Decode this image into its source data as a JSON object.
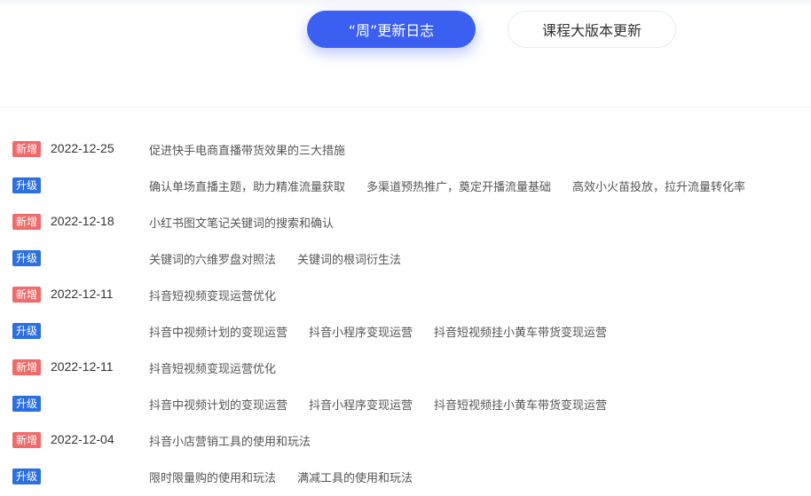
{
  "tabs": [
    {
      "label": "“周”更新日志",
      "active": true
    },
    {
      "label": "课程大版本更新",
      "active": false
    }
  ],
  "colors": {
    "accent": "#3b5ff0",
    "badge_new": "#f06a6a",
    "badge_upgrade": "#2c6fe0"
  },
  "rows": [
    {
      "badge": "新增",
      "kind": "new",
      "date": "2022-12-25",
      "items": [
        "促进快手电商直播带货效果的三大措施"
      ]
    },
    {
      "badge": "升级",
      "kind": "up",
      "date": "",
      "items": [
        "确认单场直播主题，助力精准流量获取",
        "多渠道预热推广，奠定开播流量基础",
        "高效小火苗投放，拉升流量转化率"
      ]
    },
    {
      "badge": "新增",
      "kind": "new",
      "date": "2022-12-18",
      "items": [
        "小红书图文笔记关键词的搜索和确认"
      ]
    },
    {
      "badge": "升级",
      "kind": "up",
      "date": "",
      "items": [
        "关键词的六维罗盘对照法",
        "关键词的根词衍生法"
      ]
    },
    {
      "badge": "新增",
      "kind": "new",
      "date": "2022-12-11",
      "items": [
        "抖音短视频变现运营优化"
      ]
    },
    {
      "badge": "升级",
      "kind": "up",
      "date": "",
      "items": [
        "抖音中视频计划的变现运营",
        "抖音小程序变现运营",
        "抖音短视频挂小黄车带货变现运营"
      ]
    },
    {
      "badge": "新增",
      "kind": "new",
      "date": "2022-12-11",
      "items": [
        "抖音短视频变现运营优化"
      ]
    },
    {
      "badge": "升级",
      "kind": "up",
      "date": "",
      "items": [
        "抖音中视频计划的变现运营",
        "抖音小程序变现运营",
        "抖音短视频挂小黄车带货变现运营"
      ]
    },
    {
      "badge": "新增",
      "kind": "new",
      "date": "2022-12-04",
      "items": [
        "抖音小店营销工具的使用和玩法"
      ]
    },
    {
      "badge": "升级",
      "kind": "up",
      "date": "",
      "items": [
        "限时限量购的使用和玩法",
        "满减工具的使用和玩法"
      ]
    }
  ]
}
